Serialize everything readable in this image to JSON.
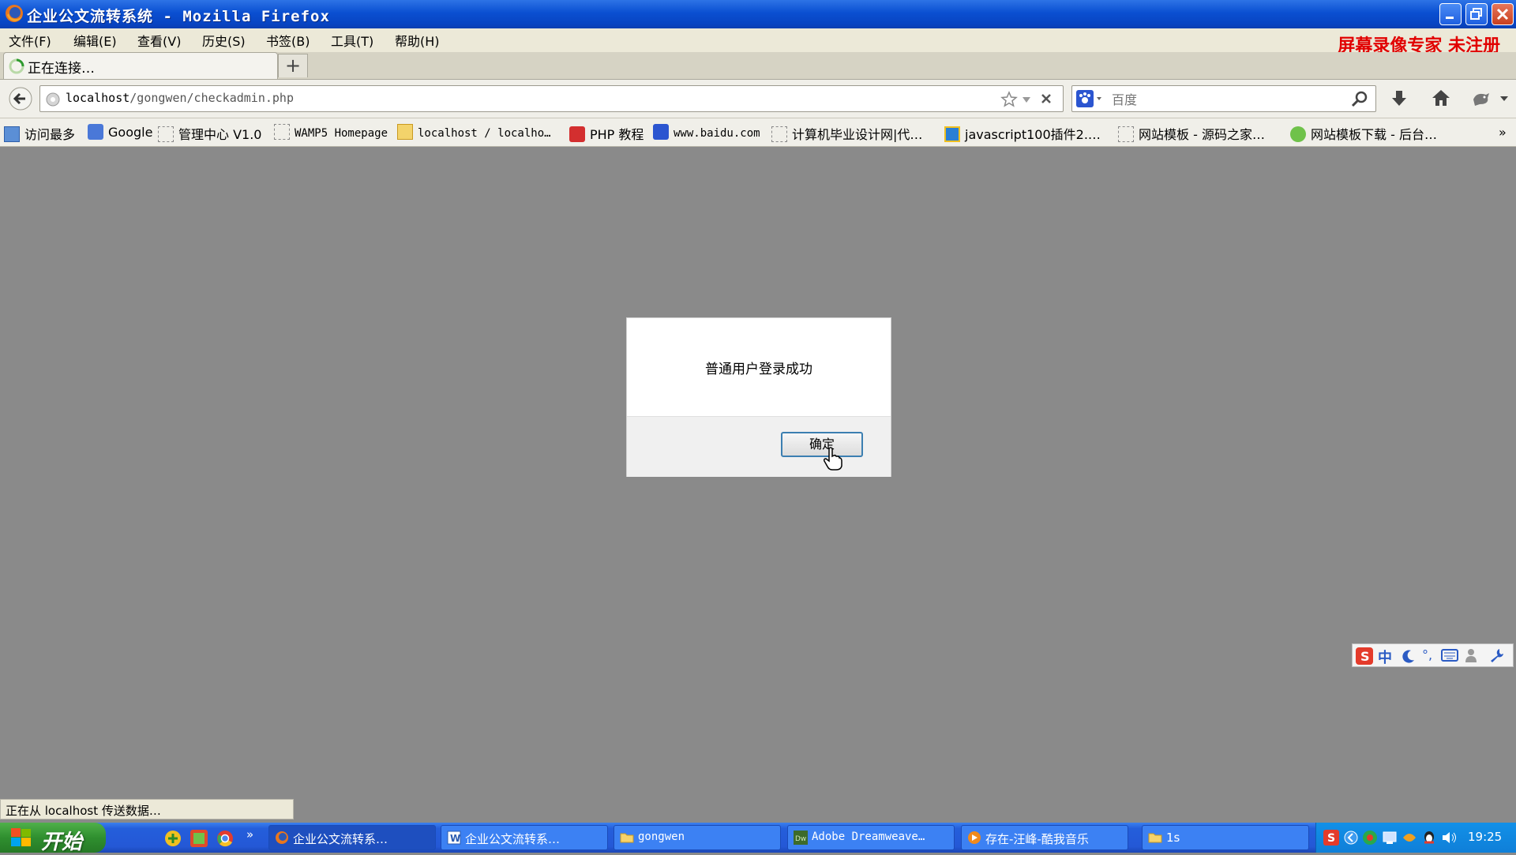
{
  "window": {
    "title": "企业公文流转系统 - Mozilla Firefox"
  },
  "menu": {
    "items": [
      "文件(F)",
      "编辑(E)",
      "查看(V)",
      "历史(S)",
      "书签(B)",
      "工具(T)",
      "帮助(H)"
    ],
    "watermark": "屏幕录像专家 未注册"
  },
  "tab": {
    "label": "正在连接…",
    "new_tab": "+"
  },
  "nav": {
    "url_host": "localhost",
    "url_path": "/gongwen/checkadmin.php",
    "search_engine": "百度",
    "search_placeholder": "百度"
  },
  "bookmarks": [
    "访问最多",
    "Google",
    "管理中心 V1.0",
    "WAMP5 Homepage",
    "localhost / localho…",
    "PHP 教程",
    "www.baidu.com",
    "计算机毕业设计网|代…",
    "javascript100插件2.…",
    "网站模板 - 源码之家…",
    "网站模板下载 - 后台…"
  ],
  "dialog": {
    "message": "普通用户登录成功",
    "ok_label": "确定"
  },
  "status": {
    "text": "正在从 localhost 传送数据…"
  },
  "taskbar": {
    "start_label": "开始",
    "quicklaunch_more": "»",
    "tasks": [
      "企业公文流转系…",
      "企业公文流转系…",
      "gongwen",
      "Adobe Dreamweave…",
      "存在-汪峰-酷我音乐",
      "1s"
    ],
    "clock": "19:25"
  },
  "ime": {
    "mode": "中"
  },
  "colors": {
    "titlebar": "#0a4fd1",
    "watermark": "#e10000",
    "content_bg": "#8a8a8a",
    "taskbar": "#245edb",
    "start": "#2f8f2f"
  }
}
